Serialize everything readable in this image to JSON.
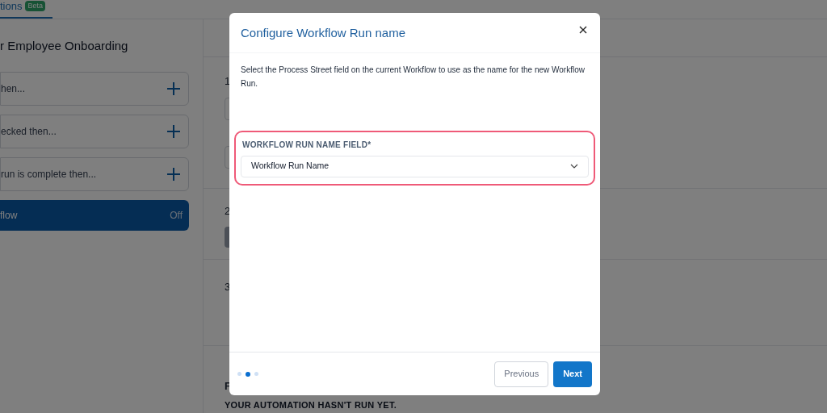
{
  "tab": {
    "label": "tions",
    "badge": "Beta",
    "selected": true
  },
  "workflow_title": "r Employee Onboarding",
  "triggers": [
    {
      "label": "hen..."
    },
    {
      "label": "ecked then..."
    },
    {
      "label": "run is complete then..."
    }
  ],
  "workflow_toggle": {
    "label": "flow",
    "state": "Off",
    "on": false
  },
  "step_fragments": [
    "1",
    "2",
    "3",
    "F"
  ],
  "run_status": "YOUR AUTOMATION HASN'T RUN YET.",
  "modal": {
    "title": "Configure Workflow Run name",
    "description": "Select the Process Street field on the current Workflow to use as the name for the new Workflow Run.",
    "field": {
      "label": "WORKFLOW RUN NAME FIELD*",
      "value": "Workflow Run Name",
      "highlighted": true
    },
    "steps": [
      {
        "selected": false
      },
      {
        "selected": true
      },
      {
        "selected": false
      }
    ],
    "buttons": [
      {
        "kind": "secondary",
        "label": "Previous"
      },
      {
        "kind": "primary",
        "label": "Next"
      }
    ]
  }
}
